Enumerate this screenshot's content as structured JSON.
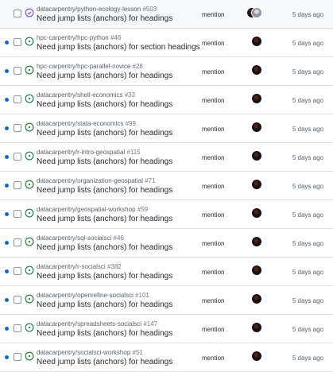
{
  "colors": {
    "unread_dot": "#0969da",
    "open_issue": "#1a7f37",
    "closed_issue": "#8250df"
  },
  "notifications": [
    {
      "repo": "datacarpentry/python-ecology-lesson",
      "number": "#503",
      "title": "Need jump lists (anchors) for headings",
      "reason": "mention",
      "time": "5 days ago",
      "unread": false,
      "state": "closed",
      "avatars": [
        "avatar-dark",
        "avatar-gray"
      ]
    },
    {
      "repo": "hpc-carpentry/hpc-python",
      "number": "#46",
      "title": "Need jump lists (anchors) for section headings",
      "reason": "mention",
      "time": "5 days ago",
      "unread": true,
      "state": "open",
      "avatars": [
        "avatar-dark"
      ]
    },
    {
      "repo": "hpc-carpentry/hpc-parallel-novice",
      "number": "#28",
      "title": "Need jump lists (anchors) for headings",
      "reason": "mention",
      "time": "5 days ago",
      "unread": true,
      "state": "open",
      "avatars": [
        "avatar-dark"
      ]
    },
    {
      "repo": "datacarpentry/shell-economics",
      "number": "#33",
      "title": "Need jump lists (anchors) for headings",
      "reason": "mention",
      "time": "5 days ago",
      "unread": true,
      "state": "open",
      "avatars": [
        "avatar-dark"
      ]
    },
    {
      "repo": "datacarpentry/stata-economics",
      "number": "#99",
      "title": "Need jump lists (anchors) for headings",
      "reason": "mention",
      "time": "5 days ago",
      "unread": true,
      "state": "open",
      "avatars": [
        "avatar-dark"
      ]
    },
    {
      "repo": "datacarpentry/r-intro-geospatial",
      "number": "#115",
      "title": "Need jump lists (anchors) for headings",
      "reason": "mention",
      "time": "5 days ago",
      "unread": true,
      "state": "open",
      "avatars": [
        "avatar-dark"
      ]
    },
    {
      "repo": "datacarpentry/organization-geospatial",
      "number": "#71",
      "title": "Need jump lists (anchors) for headings",
      "reason": "mention",
      "time": "5 days ago",
      "unread": true,
      "state": "open",
      "avatars": [
        "avatar-dark"
      ]
    },
    {
      "repo": "datacarpentry/geospatial-workshop",
      "number": "#59",
      "title": "Need jump lists (anchors) for headings",
      "reason": "mention",
      "time": "5 days ago",
      "unread": true,
      "state": "open",
      "avatars": [
        "avatar-dark"
      ]
    },
    {
      "repo": "datacarpentry/sql-socialsci",
      "number": "#46",
      "title": "Need jump lists (anchors) for headings",
      "reason": "mention",
      "time": "5 days ago",
      "unread": true,
      "state": "open",
      "avatars": [
        "avatar-dark"
      ]
    },
    {
      "repo": "datacarpentry/r-socialsci",
      "number": "#382",
      "title": "Need jump lists (anchors) for headings",
      "reason": "mention",
      "time": "5 days ago",
      "unread": true,
      "state": "open",
      "avatars": [
        "avatar-dark"
      ]
    },
    {
      "repo": "datacarpentry/openrefine-socialsci",
      "number": "#101",
      "title": "Need jump lists (anchors) for headings",
      "reason": "mention",
      "time": "5 days ago",
      "unread": true,
      "state": "open",
      "avatars": [
        "avatar-dark"
      ]
    },
    {
      "repo": "datacarpentry/spreadsheets-socialsci",
      "number": "#147",
      "title": "Need jump lists (anchors) for headings",
      "reason": "mention",
      "time": "5 days ago",
      "unread": true,
      "state": "open",
      "avatars": [
        "avatar-dark"
      ]
    },
    {
      "repo": "datacarpentry/socialsci-workshop",
      "number": "#51",
      "title": "Need jump lists (anchors) for headings",
      "reason": "mention",
      "time": "5 days ago",
      "unread": true,
      "state": "open",
      "avatars": [
        "avatar-dark"
      ]
    }
  ]
}
